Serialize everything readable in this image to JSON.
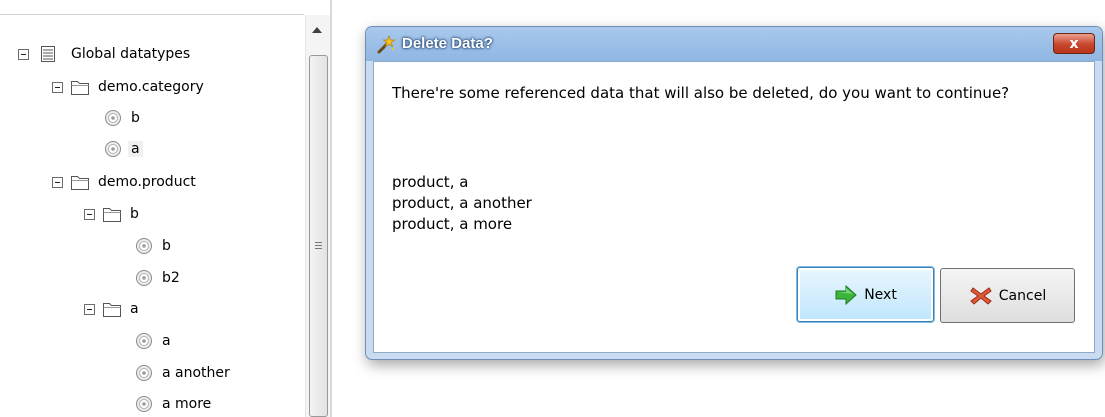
{
  "tree": {
    "root": {
      "label": "Global datatypes"
    },
    "items": [
      {
        "label": "demo.category",
        "type": "folder"
      },
      {
        "label": "b",
        "type": "record"
      },
      {
        "label": "a",
        "type": "record",
        "selected": true
      },
      {
        "label": "demo.product",
        "type": "folder"
      },
      {
        "label": "b",
        "type": "folder"
      },
      {
        "label": "b",
        "type": "record"
      },
      {
        "label": "b2",
        "type": "record"
      },
      {
        "label": "a",
        "type": "folder"
      },
      {
        "label": "a",
        "type": "record"
      },
      {
        "label": "a another",
        "type": "record"
      },
      {
        "label": "a more",
        "type": "record"
      }
    ]
  },
  "dialog": {
    "title": "Delete Data?",
    "close_label": "x",
    "message": "There're some referenced data that will also be deleted, do you want to continue?",
    "references": [
      "product, a",
      "product, a another",
      "product, a more"
    ],
    "next_label": "Next",
    "cancel_label": "Cancel",
    "icons": {
      "title": "wand-icon",
      "next": "green-arrow-icon",
      "cancel": "red-x-icon"
    }
  },
  "colors": {
    "titlebar": "#9bbfe8",
    "close_button": "#c8462c",
    "next_arrow": "#3bb43c",
    "cancel_x": "#e05a3a"
  }
}
